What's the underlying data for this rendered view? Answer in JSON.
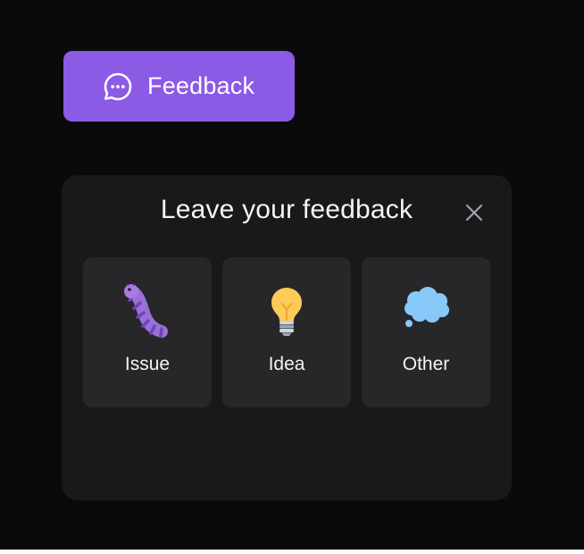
{
  "trigger": {
    "label": "Feedback",
    "icon": "chat-bubble-icon",
    "color": "#8b5be6"
  },
  "panel": {
    "title": "Leave your feedback",
    "close_icon": "close-icon",
    "options": [
      {
        "label": "Issue",
        "icon": "caterpillar-icon"
      },
      {
        "label": "Idea",
        "icon": "lightbulb-icon"
      },
      {
        "label": "Other",
        "icon": "thought-balloon-icon"
      }
    ]
  },
  "colors": {
    "background": "#0a0a0b",
    "panel": "#19191b",
    "card": "#27272a",
    "text": "#f4f4f5"
  }
}
